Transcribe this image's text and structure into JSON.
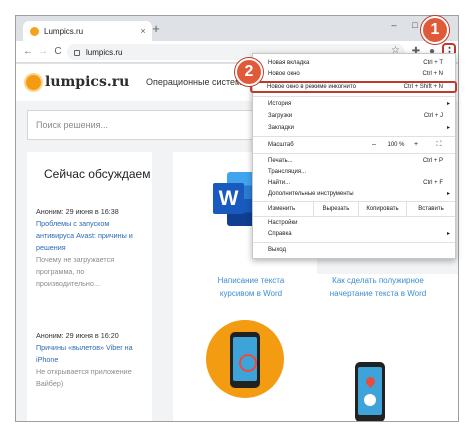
{
  "browser": {
    "tab_title": "Lumpics.ru",
    "tab_close": "×",
    "new_tab": "+",
    "window_controls": [
      "–",
      "□",
      "×"
    ],
    "url": "lumpics.ru",
    "nav": {
      "back": "←",
      "forward": "→",
      "reload": "C"
    },
    "menu_button": "⋮"
  },
  "site": {
    "logo_text": "lumpics.ru",
    "nav_text": "Операционные систем",
    "search_placeholder": "Поиск решения...",
    "sidebar_title": "Сейчас обсуждаем",
    "news": [
      {
        "date": "Аноним: 29 июня в 16:38",
        "link": "Проблемы с запуском антивируса Avast: причины и решения",
        "snippet": "Почему не загружается программа, по производительно..."
      },
      {
        "date": "Аноним: 29 июня в 16:20",
        "link": "Причины «вылетов» Viber на iPhone",
        "snippet": "Не открывается приложение Вайбер)"
      }
    ],
    "cards": [
      {
        "title": "Написание текста курсивом в Word"
      },
      {
        "title": "Как сделать полужирное начертание текста в Word"
      }
    ],
    "word_letter": "W"
  },
  "menu": {
    "items_top": [
      {
        "label": "Новая вкладка",
        "shortcut": "Ctrl + T"
      },
      {
        "label": "Новое окно",
        "shortcut": "Ctrl + N"
      },
      {
        "label": "Новое окно в режиме инкогнито",
        "shortcut": "Ctrl + Shift + N"
      }
    ],
    "items_mid": [
      {
        "label": "История",
        "arrow": "▸"
      },
      {
        "label": "Загрузки",
        "shortcut": "Ctrl + J"
      },
      {
        "label": "Закладки",
        "arrow": "▸"
      }
    ],
    "zoom": {
      "label": "Масштаб",
      "minus": "–",
      "value": "100 %",
      "plus": "+",
      "fullscreen": "⛶"
    },
    "items_tools": [
      {
        "label": "Печать...",
        "shortcut": "Ctrl + P"
      },
      {
        "label": "Трансляция..."
      },
      {
        "label": "Найти...",
        "shortcut": "Ctrl + F"
      },
      {
        "label": "Дополнительные инструменты",
        "arrow": "▸"
      }
    ],
    "edit": {
      "label": "Изменить",
      "cut": "Вырезать",
      "copy": "Копировать",
      "paste": "Вставить"
    },
    "items_bottom": [
      {
        "label": "Настройки"
      },
      {
        "label": "Справка",
        "arrow": "▸"
      }
    ],
    "exit": "Выход"
  },
  "callouts": [
    "1",
    "2"
  ],
  "colors": {
    "accent": "#e05a3a",
    "highlight_border": "#c0392b",
    "link": "#2b6bb5",
    "word_blue": "#185abd"
  }
}
